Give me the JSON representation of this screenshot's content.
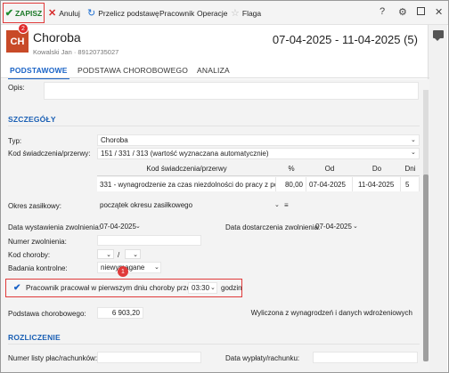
{
  "toolbar": {
    "save_label": "ZAPISZ",
    "cancel_label": "Anuluj",
    "recalc_label": "Przelicz podstawę",
    "employee_label": "Pracownik",
    "operations_label": "Operacje",
    "flag_label": "Flaga",
    "help_label": "?"
  },
  "header": {
    "avatar_initials": "CH",
    "badge_count": "2",
    "title": "Choroba",
    "subtitle": "Kowalski Jan  ·  89120735027",
    "date_range": "07-04-2025 - 11-04-2025 (5)"
  },
  "tabs": [
    "PODSTAWOWE",
    "PODSTAWA CHOROBOWEGO",
    "ANALIZA"
  ],
  "form": {
    "opis_label": "Opis:",
    "opis_value": "",
    "details_section": "SZCZEGÓŁY",
    "typ_label": "Typ:",
    "typ_value": "Choroba",
    "kod_label": "Kod świadczenia/przerwy:",
    "kod_value": "151 / 331 / 313   (wartość wyznaczana automatycznie)",
    "grid_headers": [
      "Kod świadczenia/przerwy",
      "%",
      "Od",
      "Do",
      "Dni"
    ],
    "grid_row": [
      "331 - wynagrodzenie za czas niezdolności do pracy z po...",
      "80,00",
      "07-04-2025",
      "11-04-2025",
      "5"
    ],
    "okres_label": "Okres zasiłkowy:",
    "okres_value": "początek okresu zasiłkowego",
    "data_wyst_label": "Data wystawienia zwolnienia:",
    "data_wyst_value": "07-04-2025",
    "data_dost_label": "Data dostarczenia zwolnienia:",
    "data_dost_value": "07-04-2025",
    "numer_label": "Numer zwolnienia:",
    "numer_value": "",
    "kod_choroby_label": "Kod choroby:",
    "kod_choroby_sep": "/",
    "badania_label": "Badania kontrolne:",
    "badania_value": "niewymagane",
    "marker_count": "1",
    "worked_label": "Pracownik pracował w pierwszym dniu choroby przez:",
    "worked_time": "03:30",
    "worked_unit": "godzin",
    "podstawa_label": "Podstawa chorobowego:",
    "podstawa_value": "6 903,20",
    "podstawa_note": "Wyliczona z wynagrodzeń i danych wdrożeniowych",
    "rozliczenie_section": "ROZLICZENIE",
    "numer_listy_label": "Numer listy płac/rachunków:",
    "numer_listy_value": "",
    "data_wyplaty_label": "Data wypłaty/rachunku:",
    "data_wyplaty_value": ""
  },
  "icons": {
    "save": "check-icon",
    "cancel": "x-icon",
    "recalc": "refresh-icon",
    "flag": "star-icon",
    "settings": "gear-icon",
    "maximize": "square-icon",
    "close": "close-icon",
    "comments": "chat-icon"
  },
  "colors": {
    "accent": "#1a63c6",
    "highlight": "#e03a3a",
    "avatar": "#c84a28",
    "save_text": "#1e7a2a"
  }
}
